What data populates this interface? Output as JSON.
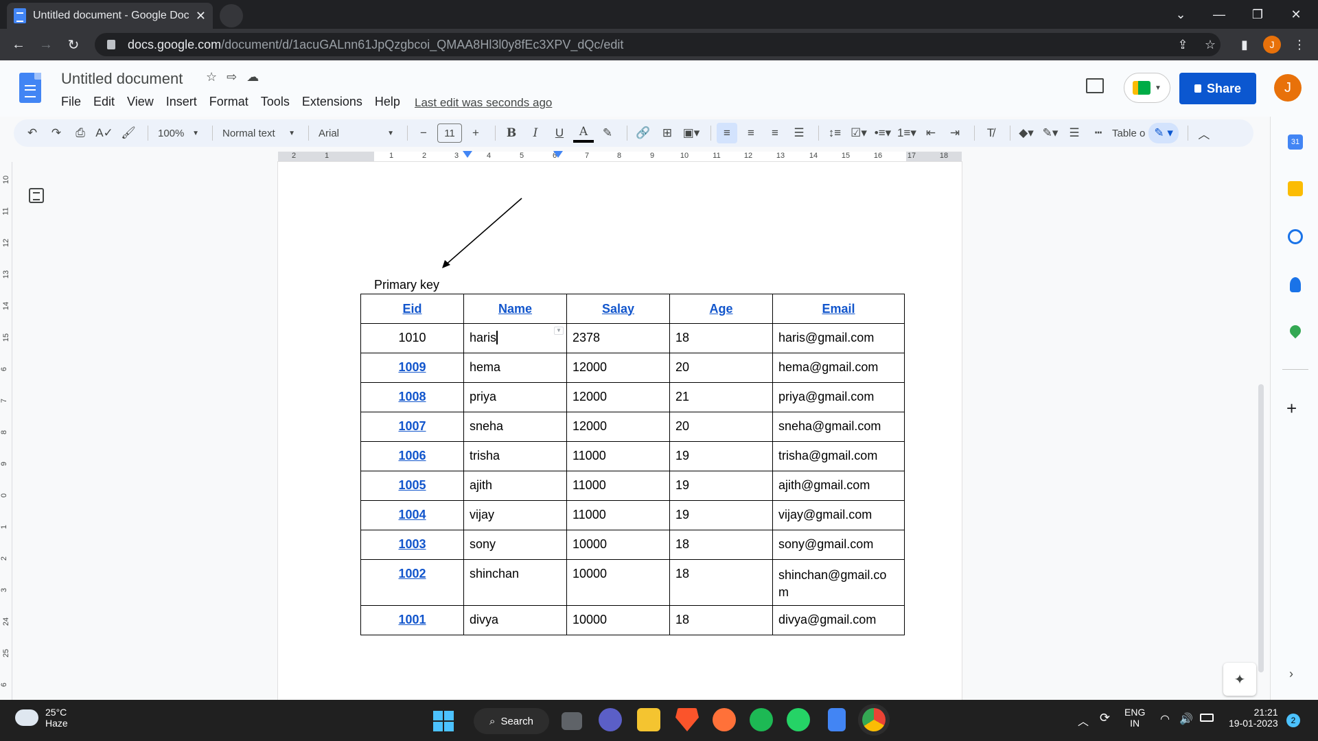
{
  "browser": {
    "tab_title": "Untitled document - Google Doc",
    "tab_close": "✕",
    "url_host": "docs.google.com",
    "url_path": "/document/d/1acuGALnn61JpQzgbcoi_QMAA8Hl3l0y8fEc3XPV_dQc/edit",
    "profile_initial": "J"
  },
  "docs": {
    "title": "Untitled document",
    "menu": [
      "File",
      "Edit",
      "View",
      "Insert",
      "Format",
      "Tools",
      "Extensions",
      "Help"
    ],
    "last_edit": "Last edit was seconds ago",
    "share_label": "Share",
    "avatar_initial": "J"
  },
  "toolbar": {
    "zoom": "100%",
    "style": "Normal text",
    "font": "Arial",
    "font_size": "11",
    "table_label": "Table o"
  },
  "ruler": {
    "numbers": [
      "2",
      "1",
      "1",
      "2",
      "3",
      "4",
      "5",
      "6",
      "7",
      "8",
      "9",
      "10",
      "11",
      "12",
      "13",
      "14",
      "15",
      "16",
      "17",
      "18"
    ]
  },
  "vruler": {
    "numbers": [
      "10",
      "11",
      "12",
      "13",
      "14",
      "15",
      "6",
      "7",
      "8",
      "9",
      "0",
      "1",
      "2",
      "3",
      "24",
      "25",
      "6"
    ]
  },
  "document": {
    "annotation": "Primary key",
    "table": {
      "headers": [
        "Eid",
        "Name",
        "Salay",
        "Age",
        "Email"
      ],
      "rows": [
        {
          "eid": "1010",
          "name": "haris",
          "salary": "2378",
          "age": "18",
          "email": "haris@gmail.com"
        },
        {
          "eid": "1009",
          "name": "hema",
          "salary": "12000",
          "age": "20",
          "email": "hema@gmail.com"
        },
        {
          "eid": "1008",
          "name": "priya",
          "salary": "12000",
          "age": "21",
          "email": "priya@gmail.com"
        },
        {
          "eid": "1007",
          "name": "sneha",
          "salary": "12000",
          "age": "20",
          "email": "sneha@gmail.com"
        },
        {
          "eid": "1006",
          "name": "trisha",
          "salary": "11000",
          "age": "19",
          "email": "trisha@gmail.com"
        },
        {
          "eid": "1005",
          "name": "ajith",
          "salary": "11000",
          "age": "19",
          "email": "ajith@gmail.com"
        },
        {
          "eid": "1004",
          "name": "vijay",
          "salary": "11000",
          "age": "19",
          "email": "vijay@gmail.com"
        },
        {
          "eid": "1003",
          "name": "sony",
          "salary": "10000",
          "age": "18",
          "email": "sony@gmail.com"
        },
        {
          "eid": "1002",
          "name": "shinchan",
          "salary": "10000",
          "age": "18",
          "email": "shinchan@gmail.co m"
        },
        {
          "eid": "1001",
          "name": "divya",
          "salary": "10000",
          "age": "18",
          "email": "divya@gmail.com"
        }
      ]
    }
  },
  "taskbar": {
    "temperature": "25°C",
    "weather": "Haze",
    "search_label": "Search",
    "lang_top": "ENG",
    "lang_bottom": "IN",
    "time": "21:21",
    "date": "19-01-2023",
    "notification_count": "2"
  },
  "colors": {
    "accent": "#0b57d0",
    "link": "#1155cc",
    "avatar": "#e8710a"
  }
}
